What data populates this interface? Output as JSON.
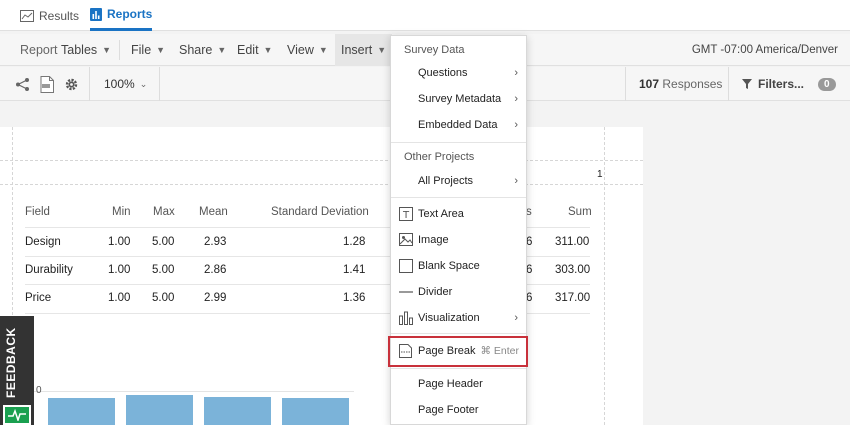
{
  "nav": {
    "results_label": "Results",
    "reports_label": "Reports"
  },
  "menubar": {
    "report_prefix": "Report",
    "report_name": "Tables",
    "file": "File",
    "share": "Share",
    "edit": "Edit",
    "view": "View",
    "insert": "Insert",
    "timezone": "GMT -07:00 America/Denver"
  },
  "toolbar": {
    "zoom": "100%",
    "responses_count": "107",
    "responses_label": "Responses",
    "filters_label": "Filters...",
    "filters_count": "0"
  },
  "page": {
    "page_number": "1"
  },
  "table": {
    "headers": [
      "Field",
      "Min",
      "Max",
      "Mean",
      "Standard Deviation",
      "s",
      "Sum"
    ],
    "rows": [
      {
        "field": "Design",
        "min": "1.00",
        "max": "5.00",
        "mean": "2.93",
        "sd": "1.28",
        "partial": "6",
        "sum": "311.00"
      },
      {
        "field": "Durability",
        "min": "1.00",
        "max": "5.00",
        "mean": "2.86",
        "sd": "1.41",
        "partial": "6",
        "sum": "303.00"
      },
      {
        "field": "Price",
        "min": "1.00",
        "max": "5.00",
        "mean": "2.99",
        "sd": "1.36",
        "partial": "6",
        "sum": "317.00"
      }
    ]
  },
  "chart": {
    "axis_label": "0"
  },
  "chart_data": {
    "type": "bar",
    "categories": [
      "",
      "",
      "",
      ""
    ],
    "values": [
      2.86,
      2.99,
      2.93,
      2.86
    ]
  },
  "feedback": {
    "label": "FEEDBACK"
  },
  "dropdown": {
    "survey_data_header": "Survey Data",
    "questions": "Questions",
    "survey_metadata": "Survey Metadata",
    "embedded_data": "Embedded Data",
    "other_projects_header": "Other Projects",
    "all_projects": "All Projects",
    "text_area": "Text Area",
    "image": "Image",
    "blank_space": "Blank Space",
    "divider": "Divider",
    "visualization": "Visualization",
    "page_break": "Page Break",
    "page_break_shortcut": "⌘ Enter",
    "page_header": "Page Header",
    "page_footer": "Page Footer"
  },
  "colors": {
    "accent": "#1a73c4",
    "bar": "#7bb3d9",
    "highlight": "#c8313b",
    "feedback_green": "#1aa050"
  }
}
